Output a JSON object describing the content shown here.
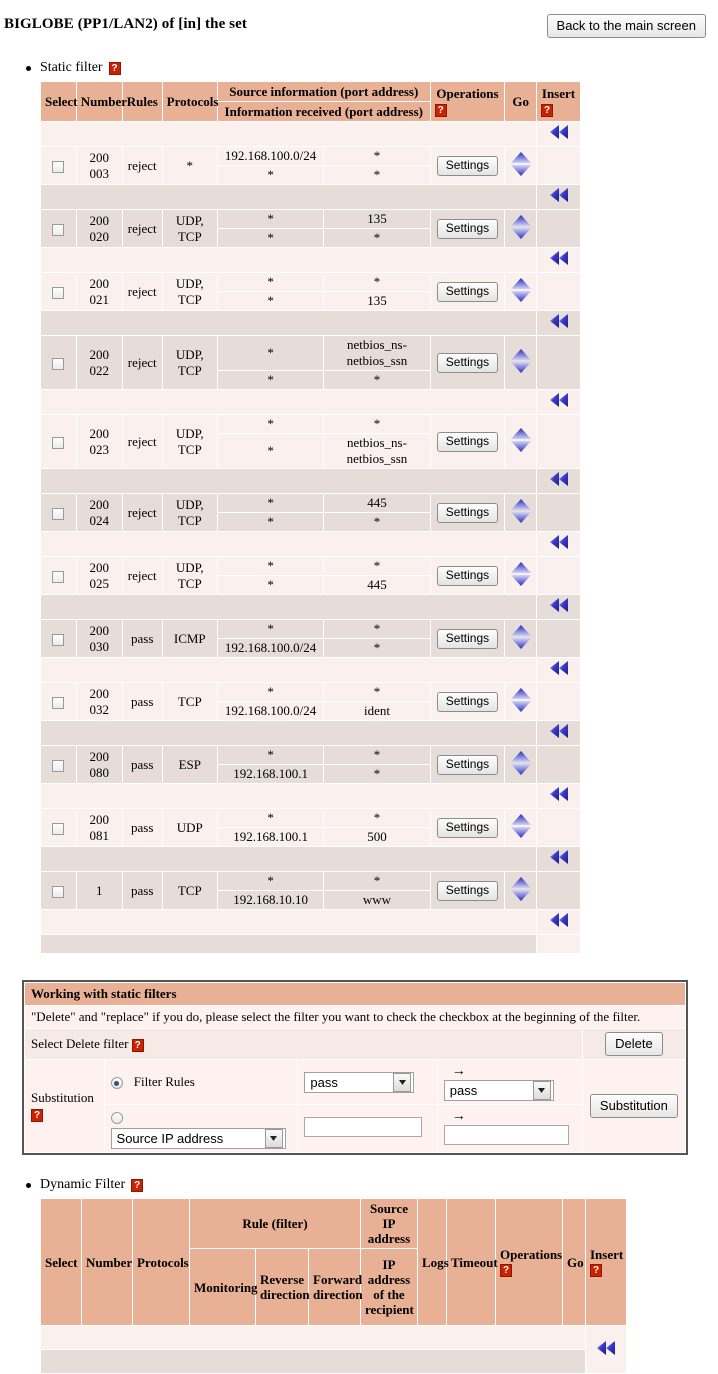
{
  "header": {
    "title": "BIGLOBE (PP1/LAN2) of [in] the set",
    "back_button": "Back to the main screen"
  },
  "icons": {
    "help": "?",
    "arrow_right": "→"
  },
  "static_filter": {
    "section_label": "Static filter",
    "columns": {
      "select": "Select",
      "number": "Number",
      "rules": "Rules",
      "protocols": "Protocols",
      "source_information": "Source information (port address)",
      "information_received": "Information received (port address)",
      "operations": "Operations",
      "go": "Go",
      "insert": "Insert"
    },
    "settings_label": "Settings",
    "rows": [
      {
        "number": [
          "200",
          "003"
        ],
        "rules": "reject",
        "protocols": [
          "*"
        ],
        "src_addr": "192.168.100.0/24",
        "src_port": "*",
        "dst_addr": "*",
        "dst_port": "*",
        "src_addr_align": "center",
        "dst_addr_align": "center"
      },
      {
        "number": [
          "200",
          "020"
        ],
        "rules": "reject",
        "protocols": [
          "UDP,",
          "TCP"
        ],
        "src_addr": "*",
        "src_port": "135",
        "dst_addr": "*",
        "dst_port": "*",
        "src_addr_align": "center",
        "dst_addr_align": "center"
      },
      {
        "number": [
          "200",
          "021"
        ],
        "rules": "reject",
        "protocols": [
          "UDP,",
          "TCP"
        ],
        "src_addr": "*",
        "src_port": "*",
        "dst_addr": "*",
        "dst_port": "135",
        "src_addr_align": "center",
        "dst_addr_align": "center"
      },
      {
        "number": [
          "200",
          "022"
        ],
        "rules": "reject",
        "protocols": [
          "UDP,",
          "TCP"
        ],
        "src_addr": "*",
        "src_port": "netbios_ns-netbios_ssn",
        "dst_addr": "*",
        "dst_port": "*",
        "src_addr_align": "center",
        "dst_addr_align": "center"
      },
      {
        "number": [
          "200",
          "023"
        ],
        "rules": "reject",
        "protocols": [
          "UDP,",
          "TCP"
        ],
        "src_addr": "*",
        "src_port": "*",
        "dst_addr": "*",
        "dst_port": "netbios_ns-netbios_ssn",
        "src_addr_align": "center",
        "dst_addr_align": "center"
      },
      {
        "number": [
          "200",
          "024"
        ],
        "rules": "reject",
        "protocols": [
          "UDP,",
          "TCP"
        ],
        "src_addr": "*",
        "src_port": "445",
        "dst_addr": "*",
        "dst_port": "*",
        "src_addr_align": "center",
        "dst_addr_align": "center"
      },
      {
        "number": [
          "200",
          "025"
        ],
        "rules": "reject",
        "protocols": [
          "UDP,",
          "TCP"
        ],
        "src_addr": "*",
        "src_port": "*",
        "dst_addr": "*",
        "dst_port": "445",
        "src_addr_align": "center",
        "dst_addr_align": "center"
      },
      {
        "number": [
          "200",
          "030"
        ],
        "rules": "pass",
        "protocols": [
          "ICMP"
        ],
        "src_addr": "*",
        "src_port": "*",
        "dst_addr": "192.168.100.0/24",
        "dst_port": "*",
        "src_addr_align": "center",
        "dst_addr_align": "center"
      },
      {
        "number": [
          "200",
          "032"
        ],
        "rules": "pass",
        "protocols": [
          "TCP"
        ],
        "src_addr": "*",
        "src_port": "*",
        "dst_addr": "192.168.100.0/24",
        "dst_port": "ident",
        "src_addr_align": "center",
        "dst_addr_align": "center"
      },
      {
        "number": [
          "200",
          "080"
        ],
        "rules": "pass",
        "protocols": [
          "ESP"
        ],
        "src_addr": "*",
        "src_port": "*",
        "dst_addr": "192.168.100.1",
        "dst_port": "*",
        "src_addr_align": "center",
        "dst_addr_align": "center"
      },
      {
        "number": [
          "200",
          "081"
        ],
        "rules": "pass",
        "protocols": [
          "UDP"
        ],
        "src_addr": "*",
        "src_port": "*",
        "dst_addr": "192.168.100.1",
        "dst_port": "500",
        "src_addr_align": "center",
        "dst_addr_align": "center"
      },
      {
        "number": [
          "1"
        ],
        "rules": "pass",
        "protocols": [
          "TCP"
        ],
        "src_addr": "*",
        "src_port": "*",
        "dst_addr": "192.168.10.10",
        "dst_port": "www",
        "src_addr_align": "center",
        "dst_addr_align": "center"
      }
    ]
  },
  "working_panel": {
    "title": "Working with static filters",
    "note": "\"Delete\" and \"replace\" if you do, please select the filter you want to check the checkbox at the beginning of the filter.",
    "select_delete_label": "Select Delete filter",
    "delete_button": "Delete",
    "substitution_label": "Substitution",
    "filter_rules_label": "Filter Rules",
    "rule_from": "pass",
    "rule_to": "pass",
    "field_select": "Source IP address",
    "value_from": "",
    "value_to": "",
    "substitution_button": "Substitution"
  },
  "dynamic_filter": {
    "section_label": "Dynamic Filter",
    "columns": {
      "select": "Select",
      "number": "Number",
      "protocols": "Protocols",
      "rule_filter": "Rule (filter)",
      "monitoring": "Monitoring",
      "reverse_direction": "Reverse direction",
      "forward_direction": "Forward direction",
      "source_ip_address": "Source IP address",
      "ip_address_of_recipient": "IP address of the recipient",
      "logs": "Logs",
      "timeout": "Timeout",
      "operations": "Operations",
      "go": "Go",
      "insert": "Insert"
    },
    "rows": []
  },
  "colors": {
    "header_bg": "#e8b195",
    "row_light": "#faf0ee",
    "row_dark": "#e6dcd8",
    "help_icon": "#cc2200",
    "arrow_blue": "#3333cc"
  }
}
